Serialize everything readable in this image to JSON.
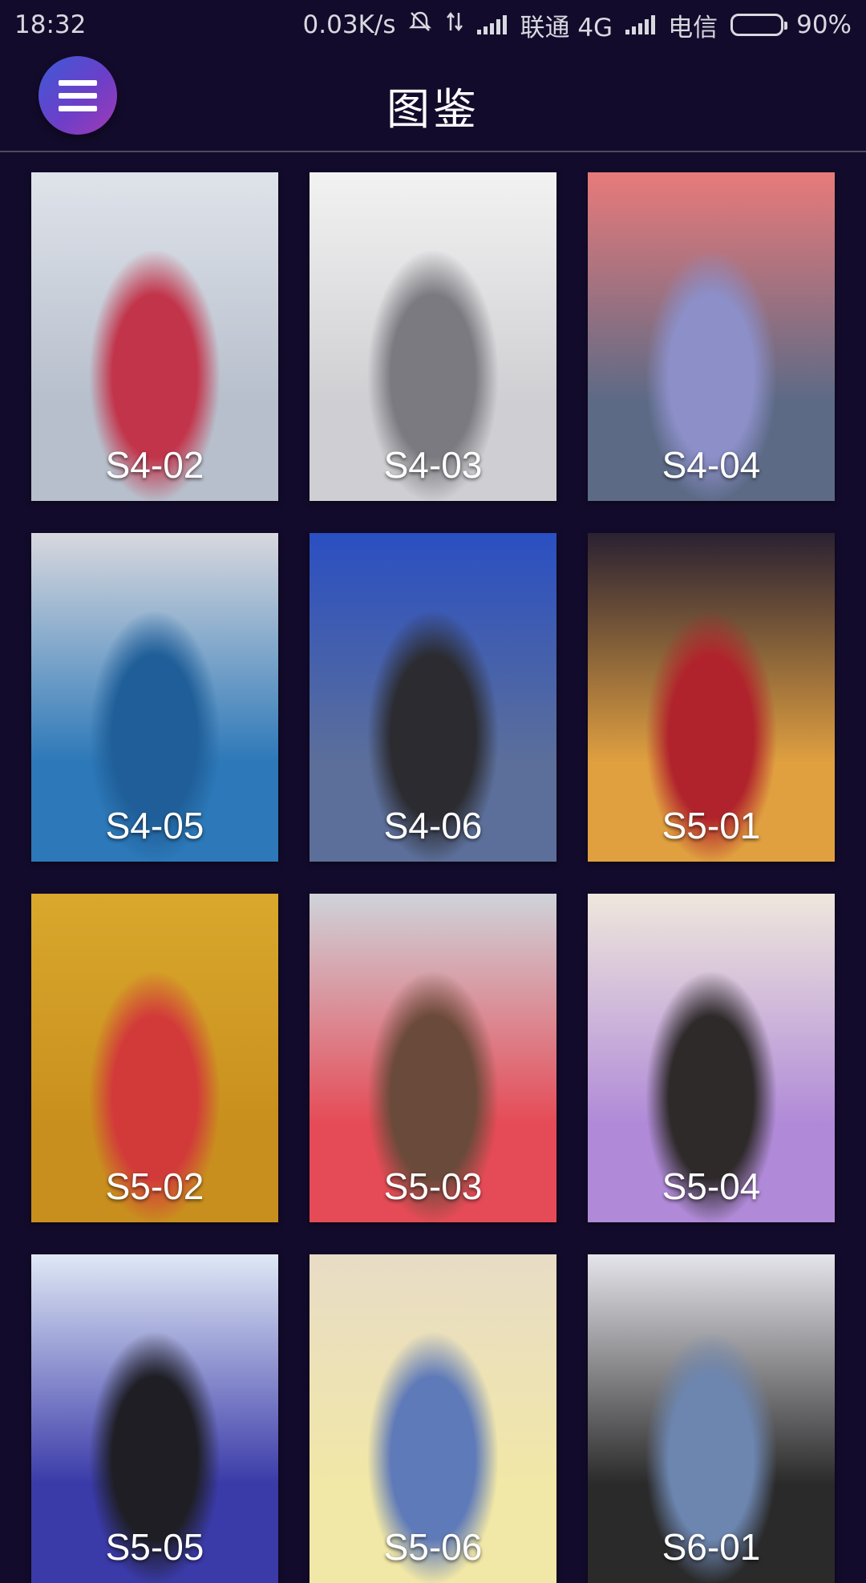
{
  "status_bar": {
    "time": "18:32",
    "net_speed": "0.03K/s",
    "carrier1": "联通 4G",
    "carrier2": "电信",
    "battery": "90%",
    "battery_level": 0.9
  },
  "header": {
    "title": "图鉴",
    "menu_icon": "hamburger-menu-icon"
  },
  "gallery": {
    "items": [
      {
        "label": "S4-02",
        "colors": [
          "#dfe3ea",
          "#b7bfcc",
          "#c2344a"
        ]
      },
      {
        "label": "S4-03",
        "colors": [
          "#f2f2f2",
          "#cfcfd3",
          "#7a7a80"
        ]
      },
      {
        "label": "S4-04",
        "colors": [
          "#e87a7a",
          "#5c6a86",
          "#8c8fc8"
        ]
      },
      {
        "label": "S4-05",
        "colors": [
          "#d8d8de",
          "#2c78b8",
          "#1f5e98"
        ]
      },
      {
        "label": "S4-06",
        "colors": [
          "#2a4fc2",
          "#5c6f9a",
          "#2b2b30"
        ]
      },
      {
        "label": "S5-01",
        "colors": [
          "#2a2132",
          "#e0a040",
          "#b0232c"
        ]
      },
      {
        "label": "S5-02",
        "colors": [
          "#d9a82c",
          "#c98f1e",
          "#d23a3a"
        ]
      },
      {
        "label": "S5-03",
        "colors": [
          "#cfd3da",
          "#e54b56",
          "#6a4a3a"
        ]
      },
      {
        "label": "S5-04",
        "colors": [
          "#efe7dc",
          "#b08ad8",
          "#2e2a2a"
        ]
      },
      {
        "label": "S5-05",
        "colors": [
          "#dfe8f5",
          "#3a3aa8",
          "#1e1e24"
        ]
      },
      {
        "label": "S5-06",
        "colors": [
          "#e8dcc6",
          "#f1e7a6",
          "#5f7ab8"
        ]
      },
      {
        "label": "S6-01",
        "colors": [
          "#e4e4ea",
          "#2a2a2a",
          "#6d86b0"
        ]
      }
    ]
  }
}
